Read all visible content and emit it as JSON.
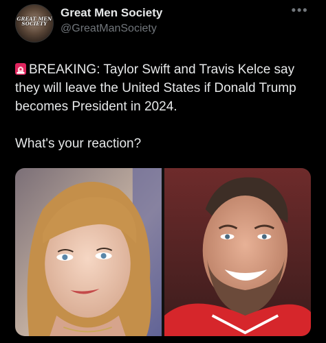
{
  "author": {
    "display_name": "Great Men Society",
    "handle": "@GreatManSociety",
    "avatar_text": "GREAT MEN SOCIETY",
    "avatar_icon": "society-logo"
  },
  "menu_icon": "more-horizontal-icon",
  "tweet": {
    "emoji": "rotating-light-siren",
    "paragraph1": "BREAKING: Taylor Swift and Travis Kelce say they will leave the United States if Donald Trump becomes President in 2024.",
    "paragraph2": "What's your reaction?"
  },
  "media": [
    {
      "name": "photo-woman-blonde-bangs"
    },
    {
      "name": "photo-man-smiling-red-jersey"
    }
  ]
}
